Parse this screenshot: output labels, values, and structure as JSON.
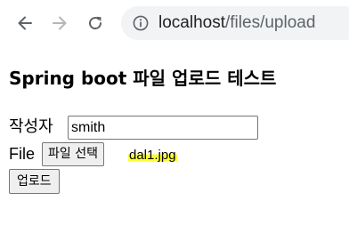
{
  "browser": {
    "url_host": "localhost",
    "url_path": "/files/upload"
  },
  "page": {
    "title": "Spring boot 파일 업로드 테스트"
  },
  "form": {
    "author_label": "작성자",
    "author_value": "smith",
    "file_label": "File",
    "file_button_label": "파일 선택",
    "selected_file": "dal1.jpg",
    "upload_button_label": "업로드"
  },
  "colors": {
    "highlight": "#ffff33",
    "omnibox_bg": "#f1f3f4"
  }
}
